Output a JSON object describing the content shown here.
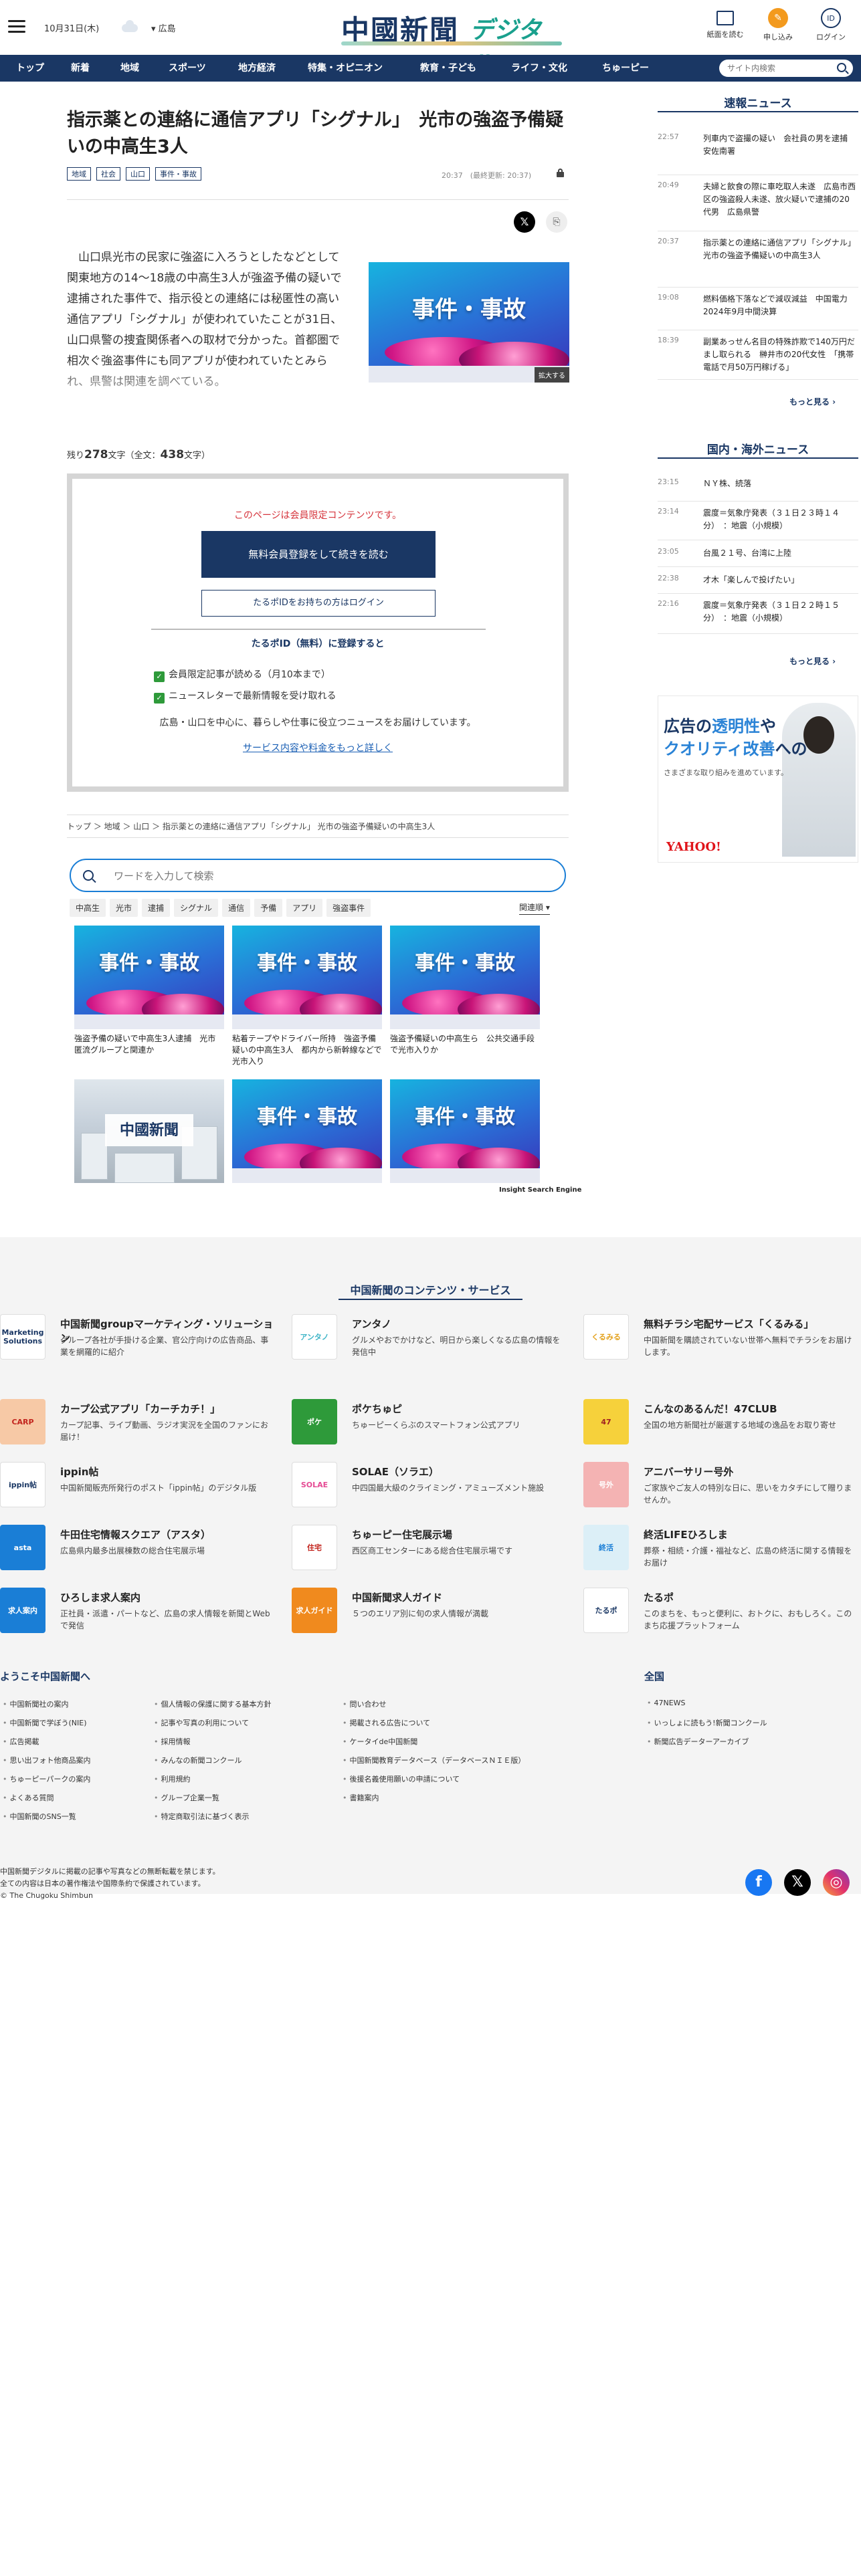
{
  "header": {
    "date": "10月31日(木)",
    "region": "広島",
    "logo_main": "中國新聞",
    "logo_sub": "デジタル",
    "btn_paper": "紙面を読む",
    "btn_apply": "申し込み",
    "btn_login": "ログイン"
  },
  "nav": {
    "items": [
      "トップ",
      "新着",
      "地域",
      "スポーツ",
      "地方経済",
      "特集・オピニオン",
      "教育・子ども",
      "ライフ・文化",
      "ちゅーピー"
    ],
    "search_placeholder": "サイト内検索"
  },
  "article": {
    "title": "指示薬との連絡に通信アプリ「シグナル」　光市の強盗予備疑いの中高生3人",
    "tags": [
      "地域",
      "社会",
      "山口",
      "事件・事故"
    ],
    "time": "20:37　(最終更新: 20:37)",
    "body": "山口県光市の民家に強盗に入ろうとしたなどとして関東地方の14～18歳の中高生3人が強盗予備の疑いで逮捕された事件で、指示役との連絡には秘匿性の高い通信アプリ「シグナル」が使われていたことが31日、山口県警の捜査関係者への取材で分かった。首都圏で相次ぐ強盗事件にも同アプリが使われていたとみられ、県警は関連を調べている。",
    "image_text": "事件・事故",
    "zoom_label": "拡大する",
    "remain_prefix": "残り",
    "remain_count": "278",
    "remain_mid": "文字（全文：",
    "total_count": "438",
    "remain_suffix": "文字）"
  },
  "paywall": {
    "note": "このページは会員限定コンテンツです。",
    "btn_register": "無料会員登録をして続きを読む",
    "btn_login": "たるポIDをお持ちの方はログイン",
    "register_heading": "たるポID（無料）に登録すると",
    "check1": "会員限定記事が読める（月10本まで）",
    "check2": "ニュースレターで最新情報を受け取れる",
    "desc": "広島・山口を中心に、暮らしや仕事に役立つニュースをお届けしています。",
    "link": "サービス内容や料金をもっと詳しく"
  },
  "breadcrumb": "トップ ＞ 地域 ＞ 山口 ＞ 指示薬との連絡に通信アプリ「シグナル」 光市の強盗予備疑いの中高生3人",
  "search": {
    "placeholder": "ワードを入力して検索",
    "keywords": [
      "中高生",
      "光市",
      "逮捕",
      "シグナル",
      "通信",
      "予備",
      "アプリ",
      "強盗事件"
    ],
    "sort": "関連順 ▾"
  },
  "related": [
    {
      "caption": "強盗予備の疑いで中高生3人逮捕　光市　匿流グループと関連か",
      "thumb": "事件・事故"
    },
    {
      "caption": "粘着テープやドライバー所持　強盗予備疑いの中高生3人　都内から新幹線などで光市入り",
      "thumb": "事件・事故"
    },
    {
      "caption": "強盗予備疑いの中高生ら　公共交通手段で光市入りか",
      "thumb": "事件・事故"
    },
    {
      "caption": "",
      "thumb": "中國新聞"
    },
    {
      "caption": "",
      "thumb": "事件・事故"
    },
    {
      "caption": "",
      "thumb": "事件・事故"
    }
  ],
  "related_footer": "Insight Search Engine",
  "sidebar": {
    "breaking_title": "速報ニュース",
    "breaking": [
      {
        "time": "22:57",
        "headline": "列車内で盗撮の疑い　会社員の男を逮捕　安佐南署"
      },
      {
        "time": "20:49",
        "headline": "夫婦と飲食の際に車吃取人未遂　広島市西区の強盗殺人未遂、放火疑いで逮捕の20代男　広島県警"
      },
      {
        "time": "20:37",
        "headline": "指示薬との連絡に通信アプリ「シグナル」光市の強盗予備疑いの中高生3人"
      },
      {
        "time": "19:08",
        "headline": "燃料価格下落などで減収減益　中国電力　2024年9月中間決算"
      },
      {
        "time": "18:39",
        "headline": "副業あっせん名目の特殊詐欺で140万円だまし取られる　榊井市の20代女性　「携帯電話で月50万円稼げる」"
      }
    ],
    "more": "もっと見る ›",
    "world_title": "国内・海外ニュース",
    "world": [
      {
        "time": "23:15",
        "headline": "ＮＹ株、続落"
      },
      {
        "time": "23:14",
        "headline": "震度＝気象庁発表（３１日２３時１４分）　：地震（小規模）"
      },
      {
        "time": "23:05",
        "headline": "台風２１号、台湾に上陸"
      },
      {
        "time": "22:38",
        "headline": "才木「楽しんで投げたい」"
      },
      {
        "time": "22:16",
        "headline": "震度＝気象庁発表（３１日２２時１５分）　：地震（小規模）"
      }
    ],
    "ad": {
      "line1a": "広告の",
      "line1b": "透明性",
      "line1c": "や",
      "line2a": "クオリティ改善",
      "line2b": "への",
      "sub": "さまざまな取り組みを進めています。",
      "brand": "YAHOO!"
    }
  },
  "footer": {
    "services_title": "中国新聞のコンテンツ・サービス",
    "services": [
      {
        "name": "中国新聞groupマーケティング・ソリューション",
        "desc": "グループ各社が手掛ける企業、官公庁向けの広告商品、事業を網羅的に紹介",
        "icon": "Marketing Solutions",
        "color": "#ffffff",
        "fg": "#1a3764"
      },
      {
        "name": "アンタノ",
        "desc": "グルメやおでかけなど、明日から楽しくなる広島の情報を発信中",
        "icon": "アンタノ",
        "color": "#ffffff",
        "fg": "#3fb5c7"
      },
      {
        "name": "無料チラシ宅配サービス「くるみる」",
        "desc": "中国新聞を購読されていない世帯へ無料でチラシをお届けします。",
        "icon": "くるみる",
        "color": "#ffffff",
        "fg": "#e3a11c"
      },
      {
        "name": "カープ公式アプリ「カーチカチ！」",
        "desc": "カープ記事、ライブ動画、ラジオ実況を全国のファンにお届け！",
        "icon": "CARP",
        "color": "#f7c9a6",
        "fg": "#c2241d"
      },
      {
        "name": "ポケちゅピ",
        "desc": "ちゅーピーくらぶのスマートフォン公式アプリ",
        "icon": "ポケ",
        "color": "#2e9a3a",
        "fg": "#ffffff"
      },
      {
        "name": "こんなのあるんだ！47CLUB",
        "desc": "全国の地方新聞社が厳選する地域の逸品をお取り寄せ",
        "icon": "47",
        "color": "#f6d13b",
        "fg": "#a02020"
      },
      {
        "name": "ippin帖",
        "desc": "中国新聞販売所発行のポスト「ippin帖」のデジタル版",
        "icon": "ippin帖",
        "color": "#ffffff",
        "fg": "#1a3764"
      },
      {
        "name": "SOLAE（ソラエ）",
        "desc": "中四国最大級のクライミング・アミューズメント施設",
        "icon": "SOLAE",
        "color": "#ffffff",
        "fg": "#e54b94"
      },
      {
        "name": "アニバーサリー号外",
        "desc": "ご家族やご友人の特別な日に、思いをカタチにして贈りませんか。",
        "icon": "号外",
        "color": "#f4b3b3",
        "fg": "#ffffff"
      },
      {
        "name": "牛田住宅情報スクエア（アスタ）",
        "desc": "広島県内最多出展棟数の総合住宅展示場",
        "icon": "asta",
        "color": "#1a7ed6",
        "fg": "#ffffff"
      },
      {
        "name": "ちゅーピー住宅展示場",
        "desc": "西区商工センターにある総合住宅展示場です",
        "icon": "住宅",
        "color": "#ffffff",
        "fg": "#c2241d"
      },
      {
        "name": "終活LIFEひろしま",
        "desc": "葬祭・相続・介護・福祉など、広島の終活に関する情報をお届け",
        "icon": "終活",
        "color": "#dceff7",
        "fg": "#1a7ed6"
      },
      {
        "name": "ひろしま求人案内",
        "desc": "正社員・派遣・パートなど、広島の求人情報を新聞とWebで発信",
        "icon": "求人案内",
        "color": "#1a7ed6",
        "fg": "#ffffff"
      },
      {
        "name": "中国新聞求人ガイド",
        "desc": "５つのエリア別に旬の求人情報が満載",
        "icon": "求人ガイド",
        "color": "#f08a1e",
        "fg": "#ffffff"
      },
      {
        "name": "たるポ",
        "desc": "このまちを、もっと便利に、おトクに、おもしろく。このまち応援プラットフォーム",
        "icon": "たるポ",
        "color": "#ffffff",
        "fg": "#1a3764"
      }
    ],
    "welcome": "ようこそ中国新聞へ",
    "col1": [
      "中国新聞社の案内",
      "中国新聞で学ぼう(NIE)",
      "広告掲載",
      "思い出フォト他商品案内",
      "ちゅーピーパークの案内",
      "よくある質問",
      "中国新聞のSNS一覧"
    ],
    "col2": [
      "個人情報の保護に関する基本方針",
      "記事や写真の利用について",
      "採用情報",
      "みんなの新聞コンクール",
      "利用規約",
      "グループ企業一覧",
      "特定商取引法に基づく表示"
    ],
    "col3": [
      "問い合わせ",
      "掲載される広告について",
      "ケータイde中国新聞",
      "中国新聞教育データベース（データベースＮＩＥ版）",
      "後援名義使用願いの申請について",
      "書籍案内"
    ],
    "all_title": "全国",
    "col4": [
      "47NEWS",
      "いっしょに読もう!新聞コンクール",
      "新聞広告データーアーカイブ"
    ],
    "copy1": "中国新聞デジタルに掲載の記事や写真などの無断転載を禁じます。",
    "copy2": "全ての内容は日本の著作権法や国際条約で保護されています。",
    "copy3": "© The Chugoku Shimbun"
  },
  "colors": {
    "navy": "#1a3764",
    "accent_orange": "#f39a1e",
    "paywall_red": "#d6353d"
  }
}
